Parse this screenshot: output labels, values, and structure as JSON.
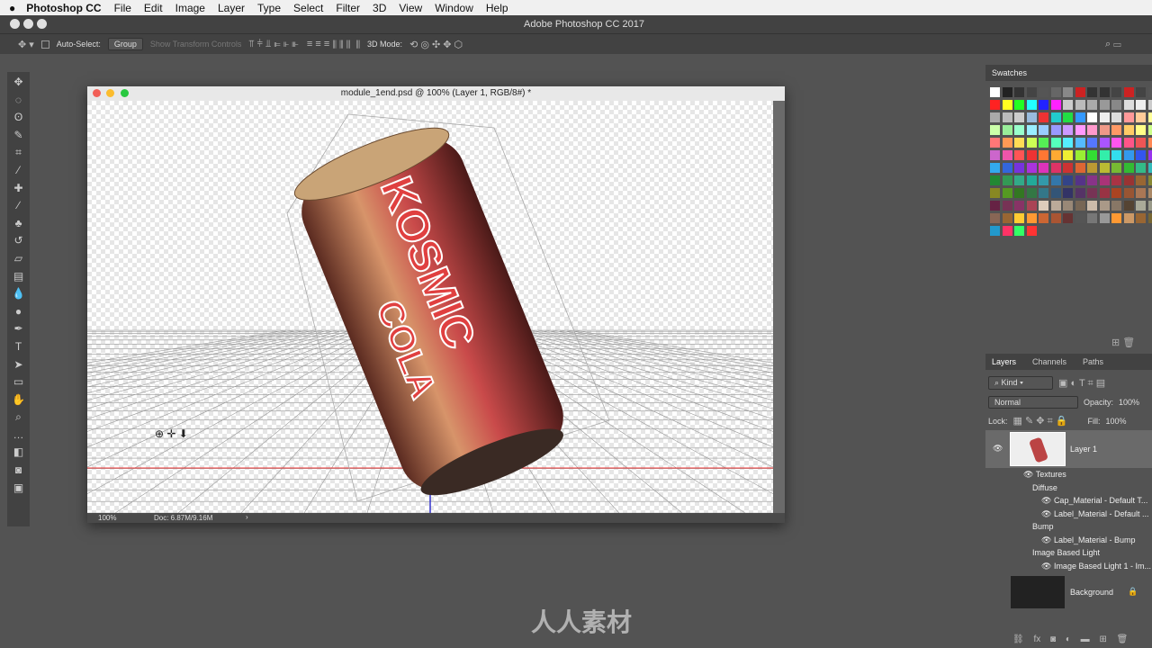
{
  "menubar": {
    "app": "Photoshop CC",
    "items": [
      "File",
      "Edit",
      "Image",
      "Layer",
      "Type",
      "Select",
      "Filter",
      "3D",
      "View",
      "Window",
      "Help"
    ]
  },
  "window_title": "Adobe Photoshop CC 2017",
  "options": {
    "auto_select": "Auto-Select:",
    "auto_select_value": "Group",
    "show_transform": "Show Transform Controls",
    "mode_3d": "3D Mode:"
  },
  "tools": [
    "move",
    "marquee",
    "lasso",
    "quick-select",
    "crop",
    "eyedropper",
    "healing",
    "brush",
    "stamp",
    "history-brush",
    "eraser",
    "gradient",
    "blur",
    "dodge",
    "pen",
    "type",
    "path-select",
    "rectangle",
    "hand",
    "zoom",
    "more",
    "colors",
    "quick-mask",
    "screen-mode"
  ],
  "document": {
    "title": "module_1end.psd @ 100% (Layer 1, RGB/8#) *",
    "zoom": "100%",
    "doc_size": "Doc: 6.87M/9.16M",
    "can_text": [
      "KOSMIC",
      "COLA"
    ]
  },
  "swatches": {
    "title": "Swatches",
    "colors": [
      "#ffffff",
      "#222",
      "#333",
      "#444",
      "#555",
      "#666",
      "#888",
      "#c22",
      "#333",
      "#333",
      "#444",
      "#c22",
      "#444",
      "#555",
      "#f22",
      "#ff2",
      "#2f2",
      "#2ff",
      "#22f",
      "#f2f",
      "#ccc",
      "#bbb",
      "#aaa",
      "#999",
      "#888",
      "#ddd",
      "#eee",
      "#ccc",
      "#aaa",
      "#bbb",
      "#ccc",
      "#9bd",
      "#e33",
      "#2cc",
      "#2d4",
      "#39f",
      "#fff",
      "#eee",
      "#ddd",
      "#f99",
      "#fc9",
      "#ff9",
      "#cfa",
      "#9e9",
      "#9fc",
      "#9ef",
      "#9cf",
      "#99f",
      "#c9f",
      "#f9f",
      "#f9c",
      "#e98",
      "#f96",
      "#fc6",
      "#ff8",
      "#cf8",
      "#f77",
      "#f95",
      "#fd5",
      "#cf5",
      "#5e5",
      "#5fb",
      "#5ef",
      "#5bf",
      "#57f",
      "#a5f",
      "#f5e",
      "#f58",
      "#e55",
      "#f85",
      "#c6c",
      "#e5a",
      "#f55",
      "#e33",
      "#f73",
      "#fa3",
      "#ee3",
      "#9e3",
      "#3d3",
      "#3ea",
      "#3de",
      "#39e",
      "#35e",
      "#93e",
      "#3ae",
      "#36d",
      "#73d",
      "#a3d",
      "#d3b",
      "#d36",
      "#c33",
      "#d63",
      "#b93",
      "#bb3",
      "#7b3",
      "#3b3",
      "#3b8",
      "#3bb",
      "#283",
      "#395",
      "#3a8",
      "#2a9",
      "#39a",
      "#37a",
      "#348",
      "#538",
      "#838",
      "#a37",
      "#a34",
      "#933",
      "#963",
      "#883",
      "#882",
      "#592",
      "#372",
      "#374",
      "#378",
      "#357",
      "#336",
      "#536",
      "#735",
      "#934",
      "#a42",
      "#953",
      "#a75",
      "#a86",
      "#624",
      "#735",
      "#836",
      "#a45",
      "#dcb",
      "#ba9",
      "#987",
      "#765",
      "#cba",
      "#a98",
      "#876",
      "#543",
      "#aa9",
      "#998",
      "#865",
      "#963",
      "#fc3",
      "#f93",
      "#c63",
      "#a53",
      "#633",
      "#555",
      "#777",
      "#999",
      "#f93",
      "#c96",
      "#963",
      "#763",
      "#29c",
      "#f36",
      "#3f6",
      "#f33"
    ]
  },
  "layers": {
    "tabs": [
      "Layers",
      "Channels",
      "Paths"
    ],
    "filter": "Kind",
    "blend": "Normal",
    "opacity_label": "Opacity:",
    "opacity": "100%",
    "lock_label": "Lock:",
    "fill_label": "Fill:",
    "fill": "100%",
    "items": [
      {
        "name": "Layer 1"
      }
    ],
    "sub": [
      {
        "text": "Textures",
        "eye": true,
        "indent": 0
      },
      {
        "text": "Diffuse",
        "eye": false,
        "indent": 1
      },
      {
        "text": "Cap_Material - Default T...",
        "eye": true,
        "indent": 2
      },
      {
        "text": "Label_Material - Default ...",
        "eye": true,
        "indent": 2
      },
      {
        "text": "Bump",
        "eye": false,
        "indent": 1
      },
      {
        "text": "Label_Material - Bump",
        "eye": true,
        "indent": 2
      },
      {
        "text": "Image Based Light",
        "eye": false,
        "indent": 1
      },
      {
        "text": "Image Based Light 1 - Im...",
        "eye": true,
        "indent": 2
      }
    ],
    "background": "Background"
  },
  "watermark": "人人素材"
}
